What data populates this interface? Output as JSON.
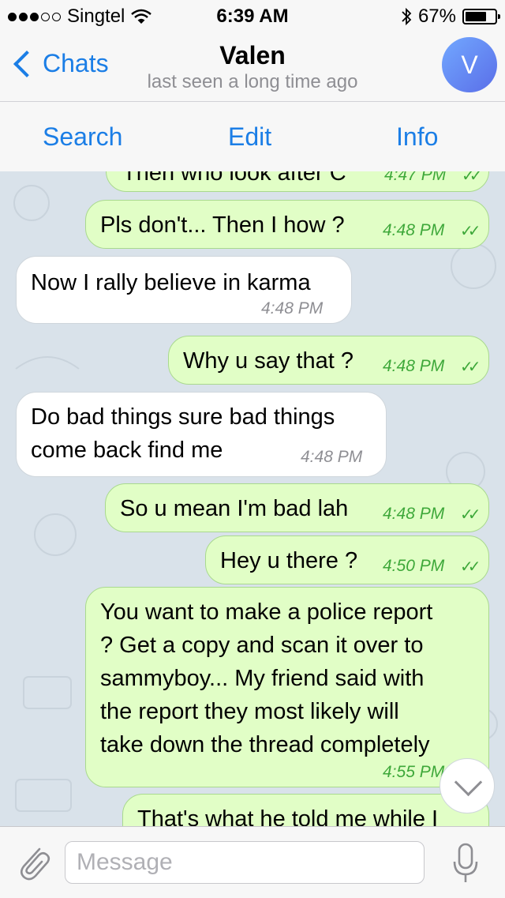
{
  "status_bar": {
    "carrier": "Singtel",
    "time": "6:39 AM",
    "battery": "67%"
  },
  "header": {
    "back_label": "Chats",
    "title": "Valen",
    "subtitle": "last seen a long time ago",
    "avatar_initial": "V"
  },
  "actions": {
    "search": "Search",
    "edit": "Edit",
    "info": "Info"
  },
  "messages": [
    {
      "dir": "out",
      "text": "Then who look after C",
      "time": "4:47 PM",
      "ticks": "✓✓"
    },
    {
      "dir": "out",
      "text": "Pls don't... Then I how ?",
      "time": "4:48 PM",
      "ticks": "✓✓"
    },
    {
      "dir": "in",
      "text": "Now I rally believe in karma",
      "time": "4:48 PM"
    },
    {
      "dir": "out",
      "text": "Why u say that ?",
      "time": "4:48 PM",
      "ticks": "✓✓"
    },
    {
      "dir": "in",
      "lines": [
        "Do bad things sure bad things",
        "come back find me"
      ],
      "time": "4:48 PM"
    },
    {
      "dir": "out",
      "text": "So u mean I'm bad lah",
      "time": "4:48 PM",
      "ticks": "✓✓"
    },
    {
      "dir": "out",
      "text": "Hey u there ?",
      "time": "4:50 PM",
      "ticks": "✓✓"
    },
    {
      "dir": "out",
      "lines": [
        "You want to make a police report",
        "? Get a copy and scan it over to",
        "sammyboy... My friend said with",
        "the report they most likely will",
        "take down the thread completely"
      ],
      "time": "4:55 PM"
    },
    {
      "dir": "out",
      "text": "That's what he told me while I",
      "time": ""
    }
  ],
  "input": {
    "placeholder": "Message"
  },
  "colors": {
    "accent": "#1b7ee6",
    "outgoing_bubble": "#e1fec6",
    "incoming_bubble": "#ffffff",
    "read_ticks": "#3ea83a"
  }
}
